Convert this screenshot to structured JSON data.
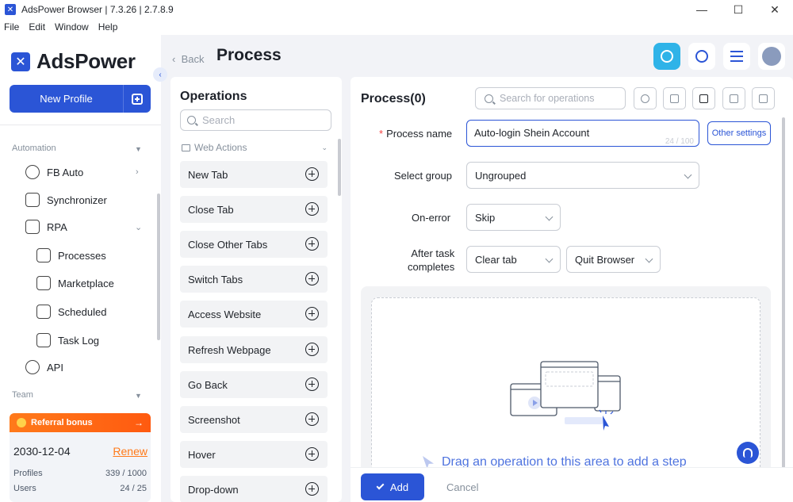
{
  "window": {
    "title": "AdsPower Browser | 7.3.26 | 2.7.8.9",
    "controls": [
      "minimize",
      "maximize",
      "close"
    ]
  },
  "menu": [
    "File",
    "Edit",
    "Window",
    "Help"
  ],
  "sidebar": {
    "brand": "AdsPower",
    "new_profile_label": "New Profile",
    "automation_label": "Automation",
    "team_label": "Team",
    "items": [
      {
        "label": "FB Auto",
        "icon": "fb-auto-icon"
      },
      {
        "label": "Synchronizer",
        "icon": "synchronizer-icon"
      },
      {
        "label": "RPA",
        "icon": "rpa-icon"
      },
      {
        "label": "Processes",
        "icon": "processes-icon"
      },
      {
        "label": "Marketplace",
        "icon": "marketplace-icon"
      },
      {
        "label": "Scheduled",
        "icon": "calendar-icon"
      },
      {
        "label": "Task Log",
        "icon": "task-log-icon"
      },
      {
        "label": "API",
        "icon": "api-icon"
      }
    ],
    "referral": {
      "title": "Referral bonus",
      "date": "2030-12-04",
      "renew": "Renew",
      "profiles_label": "Profiles",
      "profiles_value": "339 / 1000",
      "users_label": "Users",
      "users_value": "24 / 25"
    }
  },
  "header": {
    "back_label": "Back",
    "page_title": "Process"
  },
  "operations": {
    "title": "Operations",
    "search_placeholder": "Search",
    "category": "Web Actions",
    "items": [
      "New Tab",
      "Close Tab",
      "Close Other Tabs",
      "Switch Tabs",
      "Access Website",
      "Refresh Webpage",
      "Go Back",
      "Screenshot",
      "Hover",
      "Drop-down"
    ]
  },
  "process": {
    "title": "Process(0)",
    "search_placeholder": "Search for operations",
    "name_label": "Process name",
    "name_value": "Auto-login Shein Account",
    "name_count": "24 / 100",
    "other_settings_label": "Other settings",
    "group_label": "Select group",
    "group_value": "Ungrouped",
    "onerror_label": "On-error",
    "onerror_value": "Skip",
    "after_label_1": "After task",
    "after_label_2": "completes",
    "after_value_1": "Clear tab",
    "after_value_2": "Quit Browser",
    "drop_hint": "Drag an operation to this area to add a step"
  },
  "footer": {
    "add_label": "Add",
    "cancel_label": "Cancel"
  },
  "colors": {
    "accent": "#2b55d6",
    "referral": "#ff7a1a",
    "required": "#f53f3f"
  }
}
